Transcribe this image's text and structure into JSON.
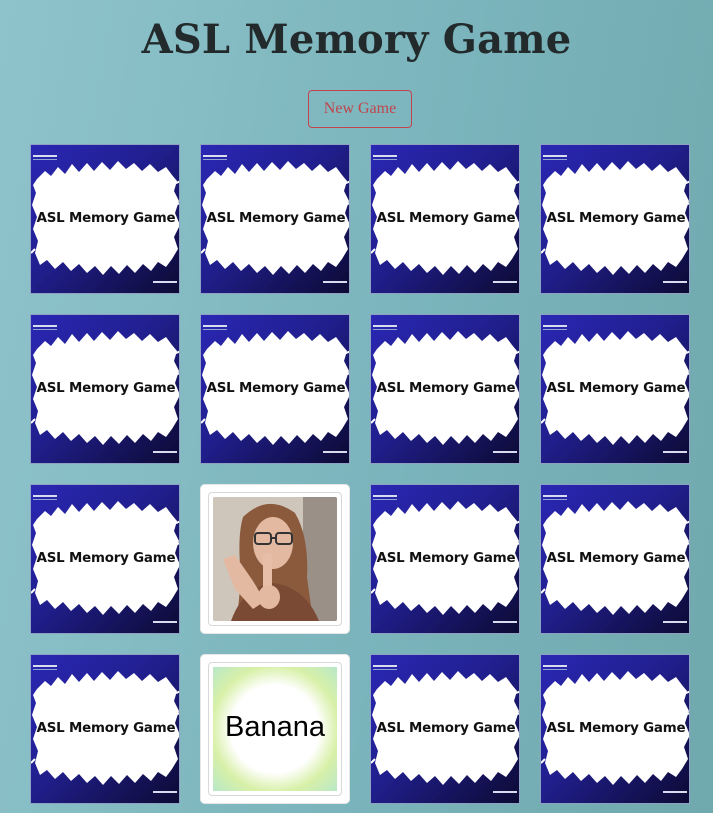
{
  "header": {
    "title": "ASL Memory Game",
    "new_game_label": "New Game"
  },
  "cards": [
    {
      "state": "back",
      "label": "ASL Memory Game"
    },
    {
      "state": "back",
      "label": "ASL Memory Game"
    },
    {
      "state": "back",
      "label": "ASL Memory Game"
    },
    {
      "state": "back",
      "label": "ASL Memory Game"
    },
    {
      "state": "back",
      "label": "ASL Memory Game"
    },
    {
      "state": "back",
      "label": "ASL Memory Game"
    },
    {
      "state": "back",
      "label": "ASL Memory Game"
    },
    {
      "state": "back",
      "label": "ASL Memory Game"
    },
    {
      "state": "back",
      "label": "ASL Memory Game"
    },
    {
      "state": "front",
      "kind": "photo"
    },
    {
      "state": "back",
      "label": "ASL Memory Game"
    },
    {
      "state": "back",
      "label": "ASL Memory Game"
    },
    {
      "state": "back",
      "label": "ASL Memory Game"
    },
    {
      "state": "front",
      "kind": "word",
      "word": "Banana"
    },
    {
      "state": "back",
      "label": "ASL Memory Game"
    },
    {
      "state": "back",
      "label": "ASL Memory Game"
    }
  ],
  "colors": {
    "accent": "#c0454c",
    "card_back_light": "#2a27b4",
    "card_back_dark": "#0c0a33",
    "title": "#222a2c"
  }
}
